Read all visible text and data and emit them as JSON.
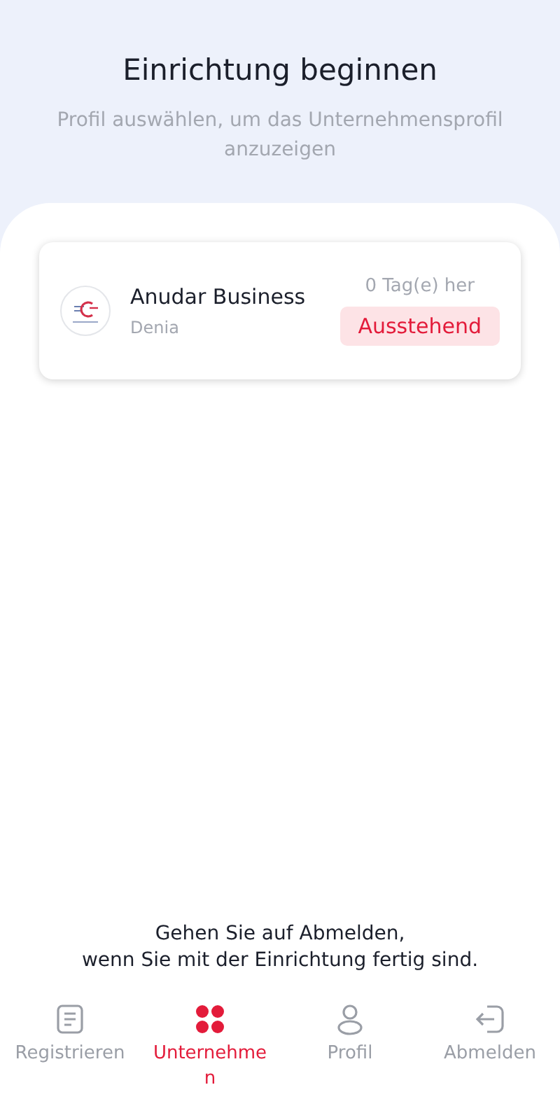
{
  "header": {
    "title": "Einrichtung beginnen",
    "subtitle": "Profil auswählen, um das Unternehmensprofil anzuzeigen"
  },
  "profiles": [
    {
      "name": "Anudar Business",
      "location": "Denia",
      "time": "0 Tag(e) her",
      "status": "Ausstehend"
    }
  ],
  "hint": [
    "Gehen Sie auf Abmelden,",
    "wenn Sie mit der Einrichtung fertig sind."
  ],
  "nav": [
    {
      "kind": "register",
      "label": "Registrieren",
      "selected": false
    },
    {
      "kind": "business",
      "label": "Unternehmen",
      "selected": true
    },
    {
      "kind": "profile",
      "label": "Profil",
      "selected": false
    },
    {
      "kind": "logout",
      "label": "Abmelden",
      "selected": false
    }
  ]
}
